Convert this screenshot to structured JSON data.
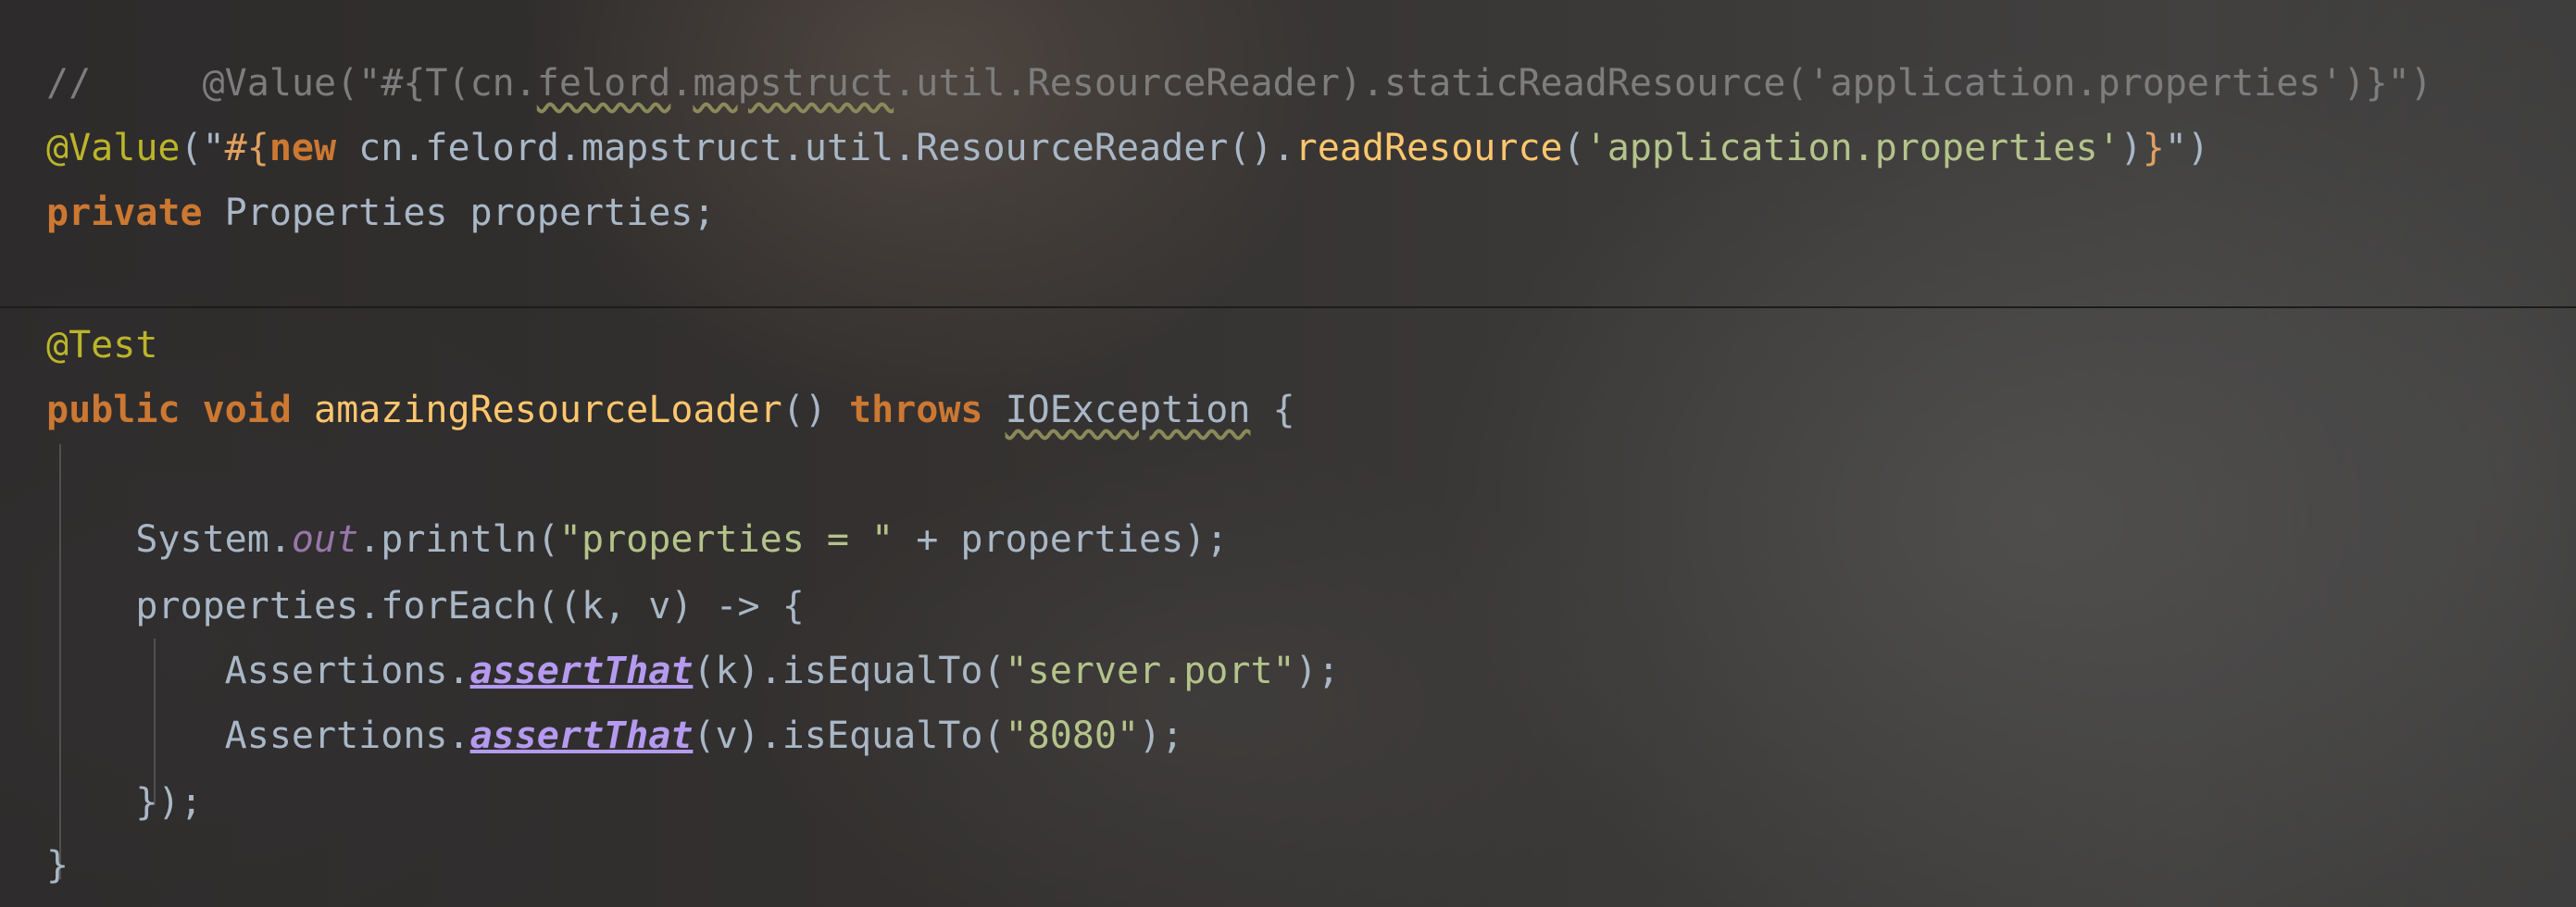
{
  "editor": {
    "lines": [
      [
        {
          "text": "//     ",
          "cls": "c-comment"
        },
        {
          "text": "@Value(\"#{T(cn.",
          "cls": "c-comment"
        },
        {
          "text": "felord",
          "cls": "c-comment c-under"
        },
        {
          "text": ".",
          "cls": "c-comment"
        },
        {
          "text": "mapstruct",
          "cls": "c-comment c-under"
        },
        {
          "text": ".util.ResourceReader).staticReadResource('application.properties')}\")",
          "cls": "c-comment"
        }
      ],
      [
        {
          "text": "@Value",
          "cls": "c-annot"
        },
        {
          "text": "(\"",
          "cls": "c-plain"
        },
        {
          "text": "#{",
          "cls": "c-brace"
        },
        {
          "text": "new ",
          "cls": "c-keyword"
        },
        {
          "text": "cn.felord.mapstruct.util.ResourceReader",
          "cls": "c-plain"
        },
        {
          "text": "().",
          "cls": "c-plain"
        },
        {
          "text": "readResource",
          "cls": "c-method"
        },
        {
          "text": "(",
          "cls": "c-plain"
        },
        {
          "text": "'application.properties'",
          "cls": "c-str-lit"
        },
        {
          "text": ")",
          "cls": "c-plain"
        },
        {
          "text": "}",
          "cls": "c-brace"
        },
        {
          "text": "\")",
          "cls": "c-plain"
        }
      ],
      [
        {
          "text": "private ",
          "cls": "c-keyword"
        },
        {
          "text": "Properties properties;",
          "cls": "c-plain"
        }
      ],
      [
        {
          "text": "@Test",
          "cls": "c-annot"
        }
      ],
      [
        {
          "text": "public ",
          "cls": "c-keyword"
        },
        {
          "text": "void ",
          "cls": "c-keyword"
        },
        {
          "text": "amazingResourceLoader",
          "cls": "c-method"
        },
        {
          "text": "() ",
          "cls": "c-plain"
        },
        {
          "text": "throws ",
          "cls": "c-keyword"
        },
        {
          "text": "IOException",
          "cls": "c-plain c-under"
        },
        {
          "text": " {",
          "cls": "c-plain"
        }
      ],
      [],
      [
        {
          "text": "    System.",
          "cls": "c-plain"
        },
        {
          "text": "out",
          "cls": "c-field"
        },
        {
          "text": ".println(",
          "cls": "c-plain"
        },
        {
          "text": "\"properties = \"",
          "cls": "c-str-lit"
        },
        {
          "text": " + properties);",
          "cls": "c-plain"
        }
      ],
      [
        {
          "text": "    properties.forEach((k, v) -> {",
          "cls": "c-plain"
        }
      ],
      [
        {
          "text": "        Assertions.",
          "cls": "c-plain"
        },
        {
          "text": "assertThat",
          "cls": "c-static"
        },
        {
          "text": "(k).isEqualTo(",
          "cls": "c-plain"
        },
        {
          "text": "\"server.port\"",
          "cls": "c-str-lit"
        },
        {
          "text": ");",
          "cls": "c-plain"
        }
      ],
      [
        {
          "text": "        Assertions.",
          "cls": "c-plain"
        },
        {
          "text": "assertThat",
          "cls": "c-static"
        },
        {
          "text": "(v).isEqualTo(",
          "cls": "c-plain"
        },
        {
          "text": "\"8080\"",
          "cls": "c-str-lit"
        },
        {
          "text": ");",
          "cls": "c-plain"
        }
      ],
      [
        {
          "text": "    });",
          "cls": "c-plain"
        }
      ],
      [
        {
          "text": "}",
          "cls": "c-plain"
        }
      ]
    ]
  }
}
